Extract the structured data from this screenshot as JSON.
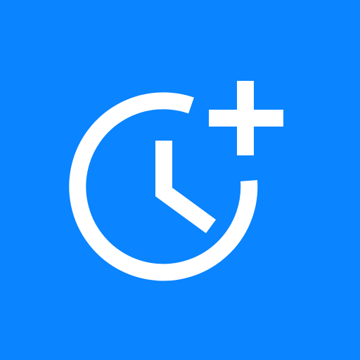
{
  "app_icon": {
    "icon": "add-alarm-icon",
    "background_color": "#0A84FF",
    "glyph_color": "#FFFFFF",
    "parts": [
      "clock-icon",
      "plus-icon"
    ]
  }
}
